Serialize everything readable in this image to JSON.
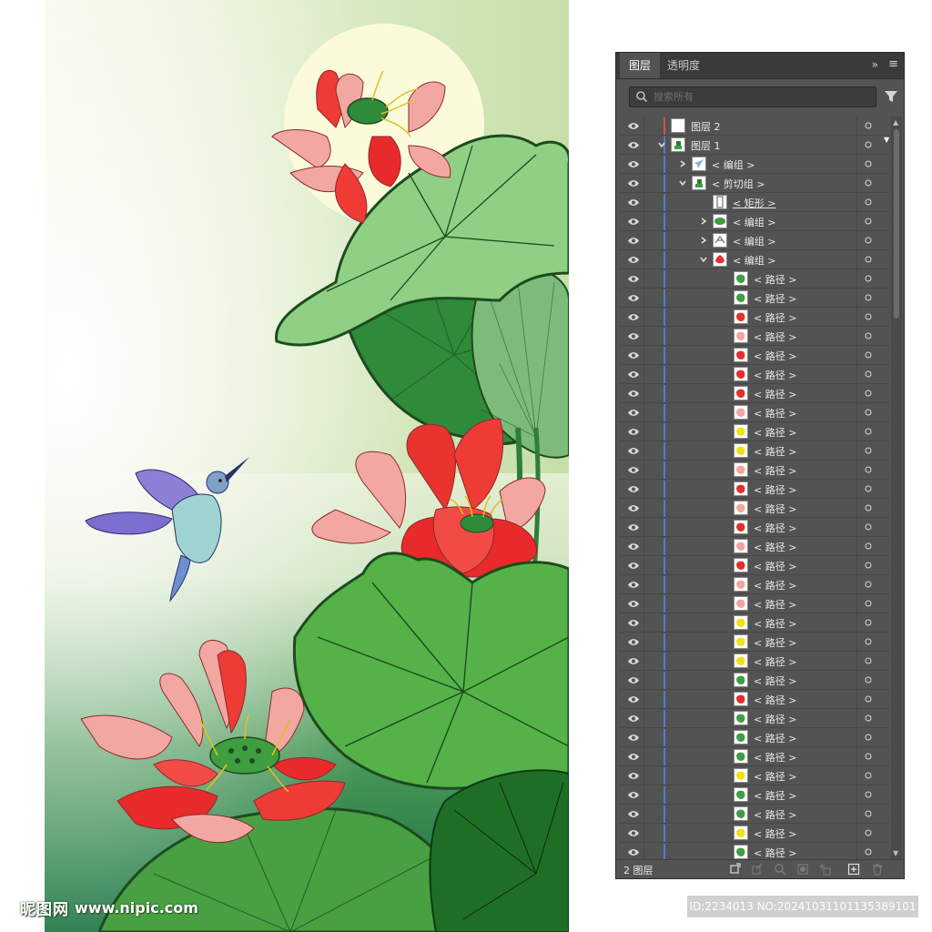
{
  "watermark": {
    "logo": "昵图网",
    "url": "www.nipic.com"
  },
  "panel": {
    "tabs": [
      {
        "label": "图层"
      },
      {
        "label": "透明度"
      }
    ],
    "collapse_glyph": "»",
    "menu_glyph": "≡",
    "search": {
      "placeholder": "搜索所有",
      "value": ""
    },
    "layer_count": "2 图层",
    "accent_colors": {
      "layer2": "#d9503a",
      "layer1": "#4a7ddb"
    },
    "rows": [
      {
        "label": "图层 2",
        "level": 0,
        "expand": "none",
        "thumb": "white",
        "bar": "#d9503a"
      },
      {
        "label": "图层 1",
        "level": 0,
        "expand": "open",
        "thumb": "plant",
        "bar": "#4a7ddb"
      },
      {
        "label": "< 编组 >",
        "level": 1,
        "expand": "closed",
        "thumb": "bird",
        "bar": "#4a7ddb"
      },
      {
        "label": "< 剪切组 >",
        "level": 1,
        "expand": "open",
        "thumb": "plant",
        "bar": "#4a7ddb"
      },
      {
        "label": "< 矩形 >",
        "level": 2,
        "expand": "none",
        "thumb": "rect",
        "bar": "#4a7ddb",
        "underline": true
      },
      {
        "label": "< 编组 >",
        "level": 2,
        "expand": "closed",
        "thumb": "leaf",
        "bar": "#4a7ddb"
      },
      {
        "label": "< 编组 >",
        "level": 2,
        "expand": "closed",
        "thumb": "sketch",
        "bar": "#4a7ddb"
      },
      {
        "label": "< 编组 >",
        "level": 2,
        "expand": "open",
        "thumb": "flower",
        "bar": "#4a7ddb"
      },
      {
        "label": "< 路径 >",
        "level": 3,
        "expand": "none",
        "thumb": "green",
        "bar": "#4a7ddb"
      },
      {
        "label": "< 路径 >",
        "level": 3,
        "expand": "none",
        "thumb": "green",
        "bar": "#4a7ddb"
      },
      {
        "label": "< 路径 >",
        "level": 3,
        "expand": "none",
        "thumb": "red",
        "bar": "#4a7ddb"
      },
      {
        "label": "< 路径 >",
        "level": 3,
        "expand": "none",
        "thumb": "pink",
        "bar": "#4a7ddb"
      },
      {
        "label": "< 路径 >",
        "level": 3,
        "expand": "none",
        "thumb": "red",
        "bar": "#4a7ddb"
      },
      {
        "label": "< 路径 >",
        "level": 3,
        "expand": "none",
        "thumb": "red",
        "bar": "#4a7ddb"
      },
      {
        "label": "< 路径 >",
        "level": 3,
        "expand": "none",
        "thumb": "red",
        "bar": "#4a7ddb"
      },
      {
        "label": "< 路径 >",
        "level": 3,
        "expand": "none",
        "thumb": "pink",
        "bar": "#4a7ddb"
      },
      {
        "label": "< 路径 >",
        "level": 3,
        "expand": "none",
        "thumb": "yellow",
        "bar": "#4a7ddb"
      },
      {
        "label": "< 路径 >",
        "level": 3,
        "expand": "none",
        "thumb": "yellow",
        "bar": "#4a7ddb"
      },
      {
        "label": "< 路径 >",
        "level": 3,
        "expand": "none",
        "thumb": "pink",
        "bar": "#4a7ddb"
      },
      {
        "label": "< 路径 >",
        "level": 3,
        "expand": "none",
        "thumb": "red",
        "bar": "#4a7ddb"
      },
      {
        "label": "< 路径 >",
        "level": 3,
        "expand": "none",
        "thumb": "pink",
        "bar": "#4a7ddb"
      },
      {
        "label": "< 路径 >",
        "level": 3,
        "expand": "none",
        "thumb": "red",
        "bar": "#4a7ddb"
      },
      {
        "label": "< 路径 >",
        "level": 3,
        "expand": "none",
        "thumb": "pink",
        "bar": "#4a7ddb"
      },
      {
        "label": "< 路径 >",
        "level": 3,
        "expand": "none",
        "thumb": "red",
        "bar": "#4a7ddb"
      },
      {
        "label": "< 路径 >",
        "level": 3,
        "expand": "none",
        "thumb": "pink",
        "bar": "#4a7ddb"
      },
      {
        "label": "< 路径 >",
        "level": 3,
        "expand": "none",
        "thumb": "pink",
        "bar": "#4a7ddb"
      },
      {
        "label": "< 路径 >",
        "level": 3,
        "expand": "none",
        "thumb": "yellow",
        "bar": "#4a7ddb"
      },
      {
        "label": "< 路径 >",
        "level": 3,
        "expand": "none",
        "thumb": "yellow",
        "bar": "#4a7ddb"
      },
      {
        "label": "< 路径 >",
        "level": 3,
        "expand": "none",
        "thumb": "yellow",
        "bar": "#4a7ddb"
      },
      {
        "label": "< 路径 >",
        "level": 3,
        "expand": "none",
        "thumb": "green",
        "bar": "#4a7ddb"
      },
      {
        "label": "< 路径 >",
        "level": 3,
        "expand": "none",
        "thumb": "red",
        "bar": "#4a7ddb"
      },
      {
        "label": "< 路径 >",
        "level": 3,
        "expand": "none",
        "thumb": "green",
        "bar": "#4a7ddb"
      },
      {
        "label": "< 路径 >",
        "level": 3,
        "expand": "none",
        "thumb": "green",
        "bar": "#4a7ddb"
      },
      {
        "label": "< 路径 >",
        "level": 3,
        "expand": "none",
        "thumb": "green",
        "bar": "#4a7ddb"
      },
      {
        "label": "< 路径 >",
        "level": 3,
        "expand": "none",
        "thumb": "yellow",
        "bar": "#4a7ddb"
      },
      {
        "label": "< 路径 >",
        "level": 3,
        "expand": "none",
        "thumb": "green",
        "bar": "#4a7ddb"
      },
      {
        "label": "< 路径 >",
        "level": 3,
        "expand": "none",
        "thumb": "green",
        "bar": "#4a7ddb"
      },
      {
        "label": "< 路径 >",
        "level": 3,
        "expand": "none",
        "thumb": "yellow",
        "bar": "#4a7ddb"
      },
      {
        "label": "< 路径 >",
        "level": 3,
        "expand": "none",
        "thumb": "green",
        "bar": "#4a7ddb"
      }
    ]
  },
  "stamp": {
    "text": "ID:2234013 NO:20241031101135389101"
  }
}
